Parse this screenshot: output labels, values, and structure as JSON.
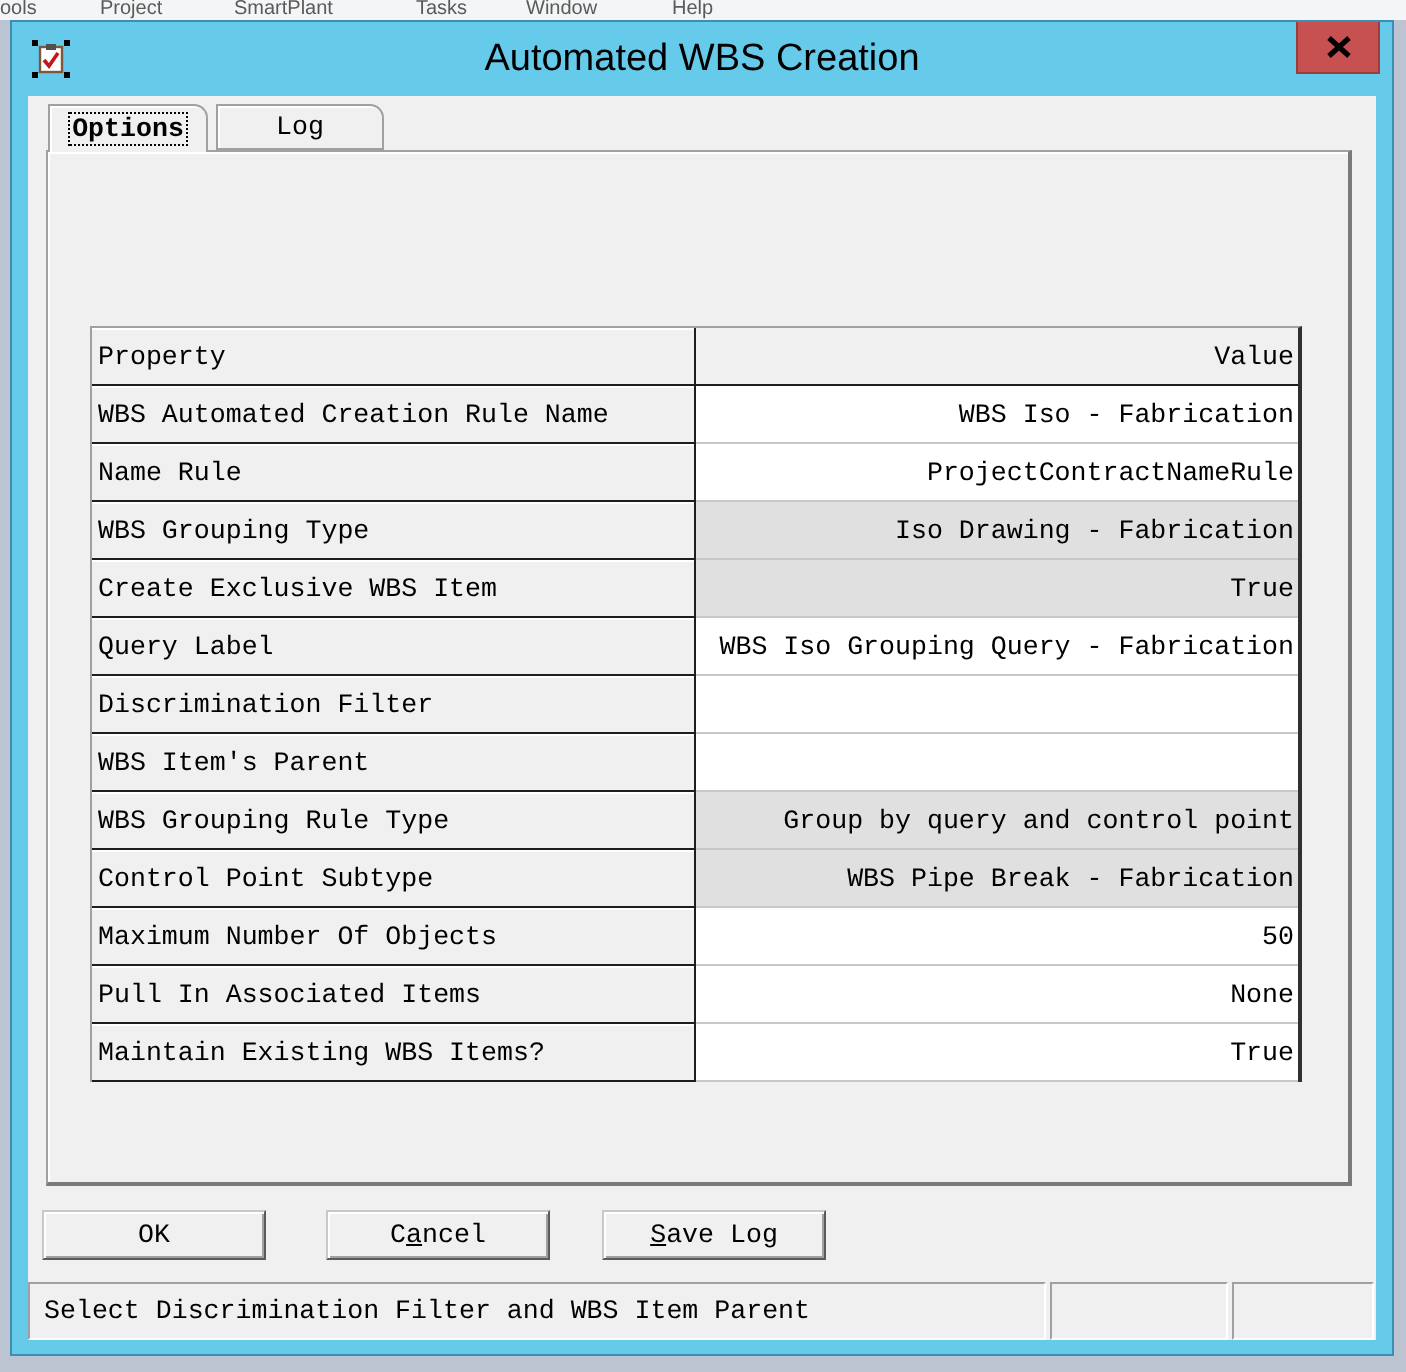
{
  "background_menu": [
    "ools",
    "Project",
    "SmartPlant",
    "Tasks",
    "Window",
    "Help"
  ],
  "window": {
    "title": "Automated WBS Creation"
  },
  "tabs": [
    {
      "label": "Options",
      "selected": true
    },
    {
      "label": "Log",
      "selected": false
    }
  ],
  "grid": {
    "columns": [
      "Property",
      "Value"
    ],
    "rows": [
      {
        "property": "WBS Automated Creation Rule Name",
        "value": "WBS Iso - Fabrication",
        "read_only": false
      },
      {
        "property": "Name Rule",
        "value": "ProjectContractNameRule",
        "read_only": false
      },
      {
        "property": "WBS Grouping Type",
        "value": "Iso Drawing - Fabrication",
        "read_only": true
      },
      {
        "property": "Create Exclusive WBS Item",
        "value": "True",
        "read_only": true
      },
      {
        "property": "Query Label",
        "value": "WBS Iso Grouping Query - Fabrication",
        "read_only": false
      },
      {
        "property": "Discrimination Filter",
        "read_only": false
      },
      {
        "property": "WBS Item's Parent",
        "read_only": false
      },
      {
        "property": "WBS Grouping Rule Type",
        "value": "Group by query and control point",
        "read_only": true
      },
      {
        "property": "Control Point Subtype",
        "value": "WBS Pipe Break - Fabrication",
        "read_only": true
      },
      {
        "property": "Maximum Number Of Objects",
        "value": "50",
        "read_only": false
      },
      {
        "property": "Pull In Associated Items",
        "value": "None",
        "read_only": false
      },
      {
        "property": "Maintain Existing WBS Items?",
        "value": "True",
        "read_only": false
      }
    ]
  },
  "buttons": [
    {
      "label_parts": [
        {
          "text": "OK",
          "underline": false
        }
      ]
    },
    {
      "label_parts": [
        {
          "text": "C",
          "underline": false
        },
        {
          "text": "a",
          "underline": true
        },
        {
          "text": "ncel",
          "underline": false
        }
      ]
    },
    {
      "label_parts": [
        {
          "text": "S",
          "underline": true
        },
        {
          "text": "ave Log",
          "underline": false
        }
      ]
    }
  ],
  "status_bar": {
    "message": "Select Discrimination Filter and WBS Item Parent"
  }
}
